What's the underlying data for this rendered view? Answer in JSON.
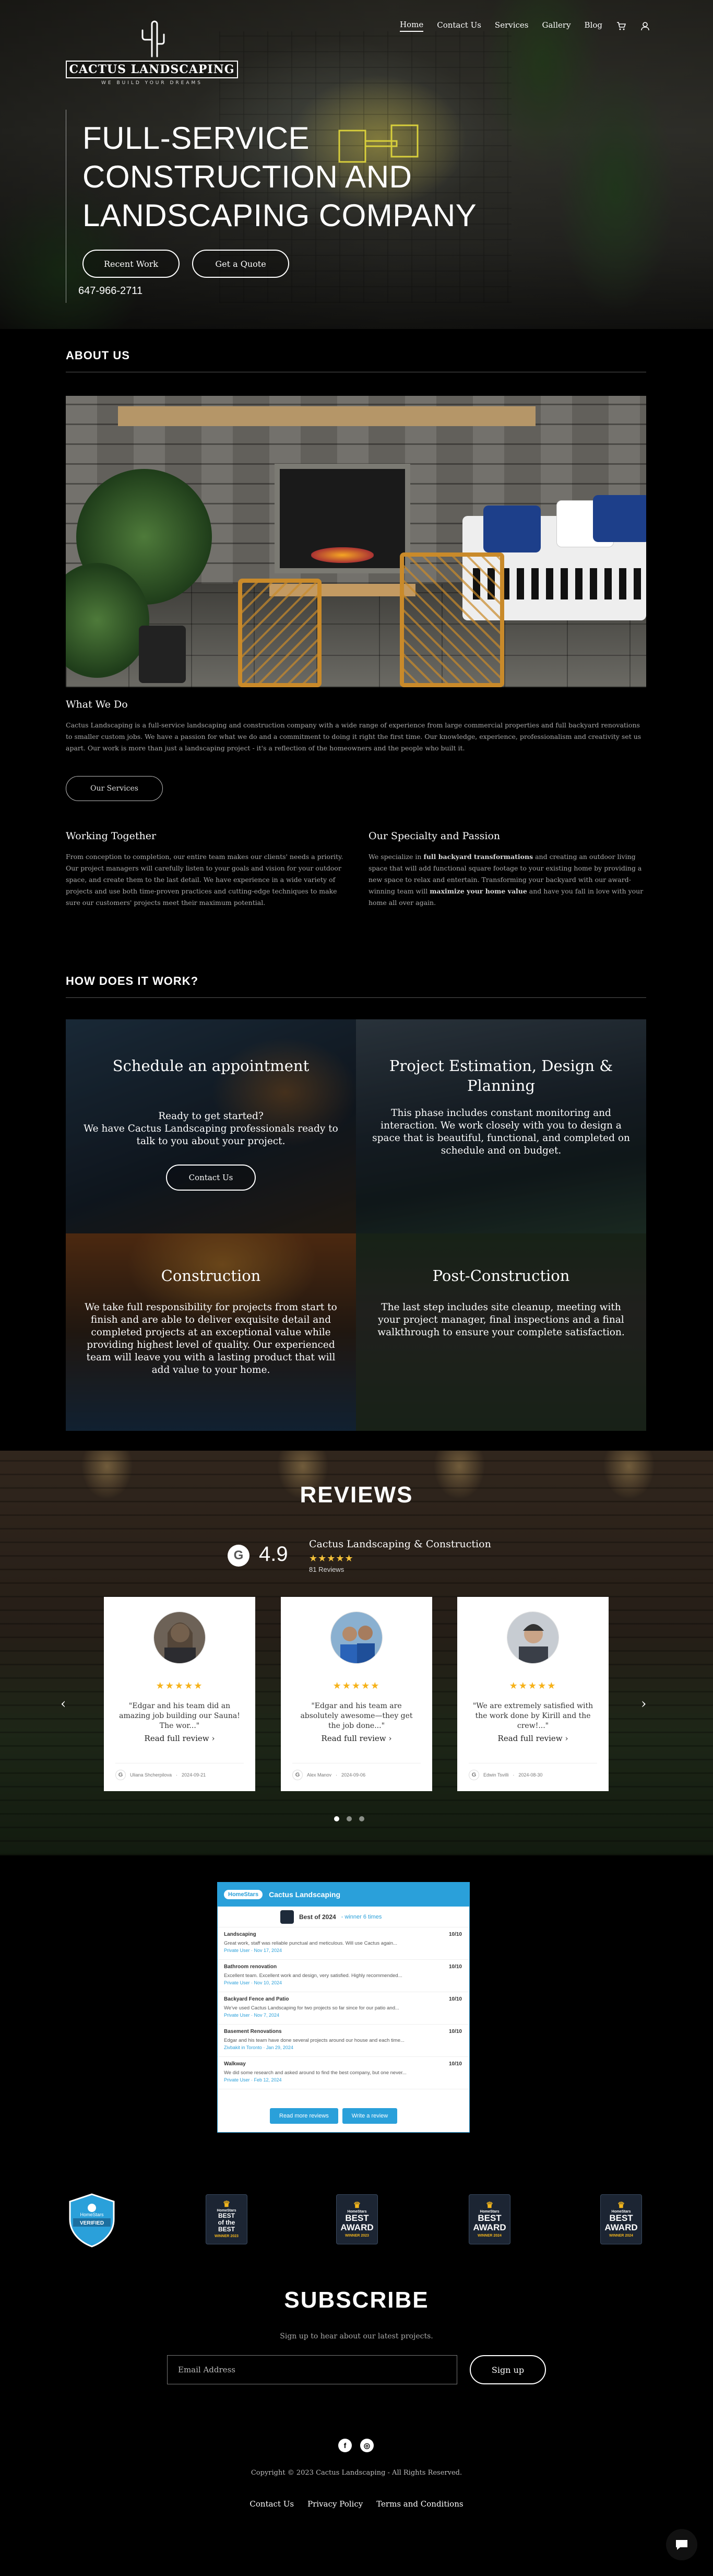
{
  "header": {
    "logo_text": "CACTUS LANDSCAPING",
    "logo_tagline": "WE BUILD YOUR DREAMS",
    "nav": [
      "Home",
      "Contact Us",
      "Services",
      "Gallery",
      "Blog"
    ],
    "cart_icon": "cart-icon",
    "account_icon": "user-icon"
  },
  "hero": {
    "title_lines": [
      "FULL-SERVICE",
      "CONSTRUCTION AND",
      "LANDSCAPING COMPANY"
    ],
    "btn_recent": "Recent Work",
    "btn_quote": "Get a Quote",
    "phone": "647-966-2711"
  },
  "about": {
    "heading": "ABOUT US",
    "what_we_do_title": "What We Do",
    "what_we_do_text": "Cactus Landscaping is a full-service landscaping and construction company with a wide range of experience from large commercial properties and full backyard renovations to smaller custom jobs. We have a passion for what we do and a commitment to doing it right the first time. Our knowledge, experience, professionalism and creativity set us apart. Our work is more than just a landscaping project - it's a reflection of the homeowners and the people who built it.",
    "services_btn": "Our Services",
    "working_title": "Working Together",
    "working_text": "From conception to completion, our entire team makes our clients' needs a priority. Our project managers will carefully listen to your goals and vision for your outdoor space, and create them to the last detail. We have experience in a wide variety of projects and use both time-proven practices and cutting-edge techniques to make sure our customers' projects meet their maximum potential.",
    "specialty_title": "Our Specialty and Passion",
    "specialty_text_1": "We specialize in ",
    "specialty_bold_1": "full backyard transformations",
    "specialty_text_2": " and creating an outdoor living space that will add functional square footage to your existing home by providing a new space to relax and entertain. Transforming your backyard with our award-winning team will ",
    "specialty_bold_2": "maximize your home value",
    "specialty_text_3": " and have you fall in love with your home all over again."
  },
  "how": {
    "heading": "HOW DOES IT WORK?",
    "tiles": [
      {
        "title": "Schedule an appointment",
        "text": "Ready to get started?\nWe have Cactus Landscaping professionals ready to talk to you about your project.",
        "btn": "Contact Us"
      },
      {
        "title": "Project Estimation, Design & Planning",
        "text": "This phase includes constant monitoring and interaction.  We work closely with you to design a space that is beautiful, functional, and completed on schedule and on budget."
      },
      {
        "title": "Construction",
        "text": "We take full responsibility for projects from start to finish and are able to deliver exquisite detail and completed projects at an exceptional value while providing highest level of quality.  Our experienced team will leave you with a lasting product that will add value to your home."
      },
      {
        "title": "Post-Construction",
        "text": "The last step includes site cleanup, meeting with your project manager, final inspections and a final walkthrough to ensure your complete satisfaction."
      }
    ]
  },
  "reviews": {
    "heading": "REVIEWS",
    "rating": "4.9",
    "business": "Cactus Landscaping & Construction",
    "stars": "★★★★★",
    "count": "81 Reviews",
    "read_more": "Read full review",
    "cards": [
      {
        "quote": "\"Edgar and his team did an amazing job building our Sauna! The wor...\"",
        "author": "Uliana Shcherpilova",
        "date": "2024-09-21",
        "stars": "★★★★★"
      },
      {
        "quote": "\"Edgar and his team are absolutely awesome—they get the job done...\"",
        "author": "Alex Manov",
        "date": "2024-09-06",
        "stars": "★★★★★"
      },
      {
        "quote": "\"We are extremely satisfied with the work done by Kirill and the crew!...\"",
        "author": "Edwin Tsvilli",
        "date": "2024-08-30",
        "stars": "★★★★★"
      }
    ]
  },
  "homestars": {
    "logo": "HomeStars",
    "business": "Cactus Landscaping",
    "best_of": "Best of 2024",
    "winner": "- winner 6 times",
    "rows": [
      {
        "title": "Landscaping",
        "score": "10/10",
        "desc": "Great work, staff was reliable punctual and meticulous. Will use Cactus again...",
        "meta": "Private User · Nov 17, 2024"
      },
      {
        "title": "Bathroom renovation",
        "score": "10/10",
        "desc": "Excellent team. Excellent work and design, very satisfied. Highly recommended...",
        "meta": "Private User · Nov 10, 2024"
      },
      {
        "title": "Backyard Fence and Patio",
        "score": "10/10",
        "desc": "We've used Cactus Landscaping for two projects so far since for our patio and...",
        "meta": "Private User · Nov 7, 2024"
      },
      {
        "title": "Basement Renovations",
        "score": "10/10",
        "desc": "Edgar and his team have done several projects around our house and each time...",
        "meta": "Zivbakit in Toronto · Jan 29, 2024"
      },
      {
        "title": "Walkway",
        "score": "10/10",
        "desc": "We did some research and asked around to find the best company, but one never...",
        "meta": "Private User · Feb 12, 2024"
      }
    ],
    "read_more": "Read more reviews",
    "write": "Write a review"
  },
  "badges": [
    {
      "crown": "♛",
      "top": "HomeStars",
      "big": "BEST\nof the\nBEST",
      "sm": "WINNER 2023"
    },
    {
      "crown": "♛",
      "top": "HomeStars",
      "big": "BEST\nAWARD",
      "sm": "WINNER 2023"
    },
    {
      "crown": "♛",
      "top": "HomeStars",
      "big": "BEST\nAWARD",
      "sm": "WINNER 2024"
    },
    {
      "crown": "♛",
      "top": "HomeStars",
      "big": "BEST\nAWARD",
      "sm": "WINNER 2024"
    }
  ],
  "verified_badge": {
    "top": "HomeStars",
    "label": "VERIFIED"
  },
  "subscribe": {
    "heading": "SUBSCRIBE",
    "text": "Sign up to hear about our latest projects.",
    "placeholder": "Email Address",
    "btn": "Sign up"
  },
  "footer": {
    "social": [
      "f",
      "◎"
    ],
    "copyright": "Copyright © 2023 Cactus Landscaping - All Rights Reserved.",
    "links": [
      "Contact Us",
      "Privacy Policy",
      "Terms and Conditions"
    ]
  }
}
